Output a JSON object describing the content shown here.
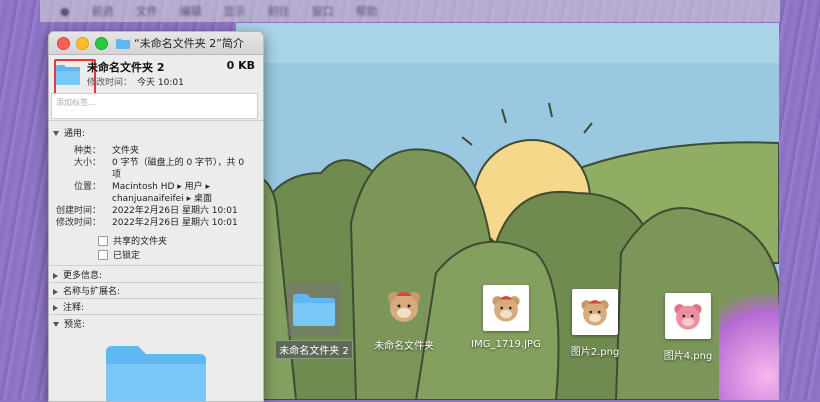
{
  "menubar": {
    "items": [
      "",
      "前进",
      "文件",
      "编辑",
      "显示",
      "前往",
      "窗口",
      "帮助"
    ]
  },
  "info_panel": {
    "window_title": "“未命名文件夹 2”简介",
    "name": "未命名文件夹 2",
    "size": "0 KB",
    "modified_label": "修改时间：",
    "modified_value": "今天 10:01",
    "tags_placeholder": "添加标签...",
    "general": {
      "header": "通用:",
      "kind_label": "种类：",
      "kind_value": "文件夹",
      "size_label": "大小：",
      "size_value": "0 字节（磁盘上的 0 字节），共 0",
      "size_value2": "项",
      "where_label": "位置：",
      "where_value": "Macintosh HD ▸ 用户 ▸",
      "where_value2": "chanjuanaifeifei ▸ 桌面",
      "created_label": "创建时间：",
      "created_value": "2022年2月26日 星期六 10:01",
      "modified_label": "修改时间：",
      "modified_value": "2022年2月26日 星期六 10:01",
      "shared_label": "共享的文件夹",
      "locked_label": "已锁定"
    },
    "more_info": "更多信息:",
    "name_ext": "名称与扩展名:",
    "comments": "注释:",
    "preview": "预览:"
  },
  "desktop_files": [
    {
      "label": "未命名文件夹 2",
      "icon": "folder-icon",
      "selected": true
    },
    {
      "label": "未命名文件夹",
      "icon": "bear-icon",
      "selected": false
    },
    {
      "label": "IMG_1719.JPG",
      "icon": "photo-icon",
      "selected": false
    },
    {
      "label": "图片2.png",
      "icon": "photo-icon",
      "selected": false
    },
    {
      "label": "图片4.png",
      "icon": "photo-icon",
      "selected": false
    }
  ],
  "colors": {
    "folder_blue": "#5fb6f0",
    "accent_red": "#e03a3a"
  }
}
